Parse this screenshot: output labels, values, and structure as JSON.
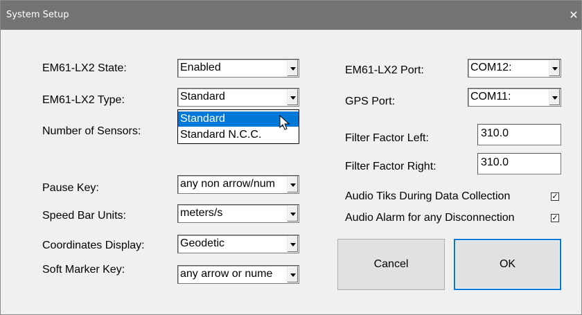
{
  "window": {
    "title": "System Setup",
    "close_glyph": "✕"
  },
  "left": {
    "state": {
      "label": "EM61-LX2 State:",
      "value": "Enabled"
    },
    "type": {
      "label": "EM61-LX2 Type:",
      "value": "Standard"
    },
    "sensors": {
      "label": "Number of Sensors:"
    },
    "pause_key": {
      "label": "Pause Key:",
      "value": "any non arrow/num"
    },
    "speed_units": {
      "label": "Speed Bar Units:",
      "value": "meters/s"
    },
    "coordinates": {
      "label": "Coordinates Display:",
      "value": "Geodetic"
    },
    "soft_marker": {
      "label": "Soft Marker Key:",
      "value": "any arrow or nume"
    }
  },
  "type_dropdown": {
    "options": [
      "Standard",
      "Standard N.C.C."
    ],
    "highlighted": "Standard"
  },
  "right": {
    "port": {
      "label": "EM61-LX2 Port:",
      "value": "COM12:"
    },
    "gps_port": {
      "label": "GPS Port:",
      "value": "COM11:"
    },
    "filter_left": {
      "label": "Filter Factor Left:",
      "value": "310.0"
    },
    "filter_right": {
      "label": "Filter Factor Right:",
      "value": "310.0"
    },
    "audio_tiks": {
      "label": "Audio Tiks During Data Collection",
      "checked": true,
      "mark": "✓"
    },
    "audio_alarm": {
      "label": "Audio Alarm for any Disconnection",
      "checked": true,
      "mark": "✓"
    }
  },
  "buttons": {
    "cancel": "Cancel",
    "ok": "OK"
  },
  "colors": {
    "titlebar": "#737373",
    "selection": "#0078d7",
    "dialog_bg": "#f0f0f0"
  },
  "icons": {
    "cursor": "mouse-pointer-icon",
    "dropdown_arrow": "chevron-down-icon",
    "close": "close-icon"
  }
}
